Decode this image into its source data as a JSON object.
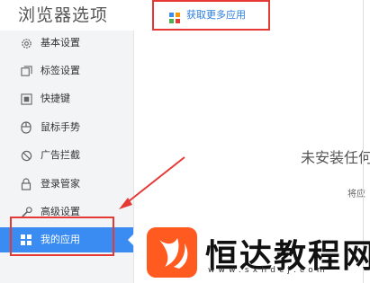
{
  "window": {
    "title": "浏览器选项"
  },
  "sidebar": {
    "items": [
      {
        "label": "基本设置",
        "icon": "gear-icon"
      },
      {
        "label": "标签设置",
        "icon": "tabs-icon"
      },
      {
        "label": "快捷键",
        "icon": "keyboard-icon"
      },
      {
        "label": "鼠标手势",
        "icon": "mouse-icon"
      },
      {
        "label": "广告拦截",
        "icon": "block-icon"
      },
      {
        "label": "登录管家",
        "icon": "lock-icon"
      },
      {
        "label": "高级设置",
        "icon": "wrench-icon"
      },
      {
        "label": "我的应用",
        "icon": "apps-icon",
        "active": true
      }
    ]
  },
  "main": {
    "more_apps_link": "获取更多应用",
    "empty_title": "未安装任何",
    "empty_subtitle": "将应"
  },
  "watermark": {
    "brand": "恒达教程网",
    "url": "www.sxhdcj.com"
  },
  "colors": {
    "accent": "#3b8cf2",
    "highlight": "#e53935",
    "link": "#2b7de0",
    "logo": "#ff5a1f"
  }
}
